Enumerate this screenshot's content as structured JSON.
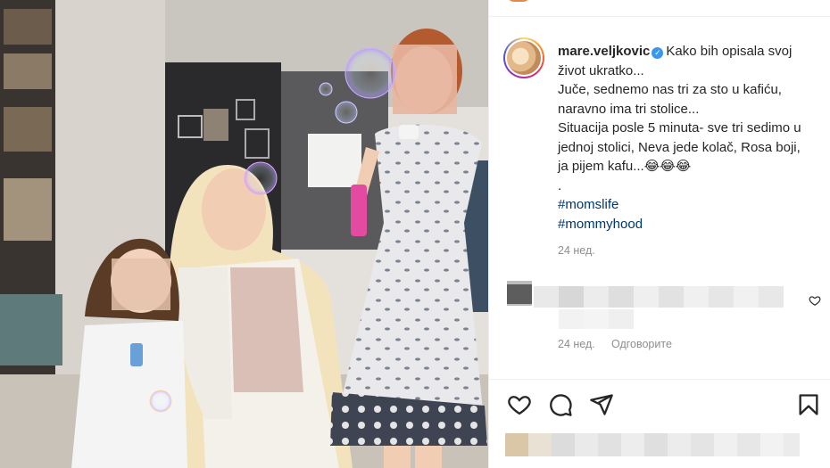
{
  "post": {
    "username": "mare.veljkovic",
    "verified_icon": "verified-badge-icon",
    "caption_lines": [
      "Kako bih opisala svoj",
      "život ukratko...",
      "Juče, sednemo nas tri za sto u kafiću,",
      "naravno ima tri stolice...",
      "Situacija posle 5 minuta- sve tri sedimo u",
      "jednoj stolici, Neva jede kolač, Rosa boji,",
      "ja pijem kafu...😂😂😂",
      "."
    ],
    "hashtags": [
      "#momslife",
      "#mommyhood"
    ],
    "time": "24 нед."
  },
  "comment": {
    "time": "24 нед.",
    "reply_label": "Одговорите",
    "like_icon": "heart-outline-icon"
  },
  "actions": {
    "icons": [
      "heart-icon",
      "comment-icon",
      "share-icon",
      "bookmark-icon"
    ]
  },
  "colors": {
    "hashtag": "#00376b",
    "meta_text": "#8e8e8e",
    "verified": "#3897f0"
  }
}
